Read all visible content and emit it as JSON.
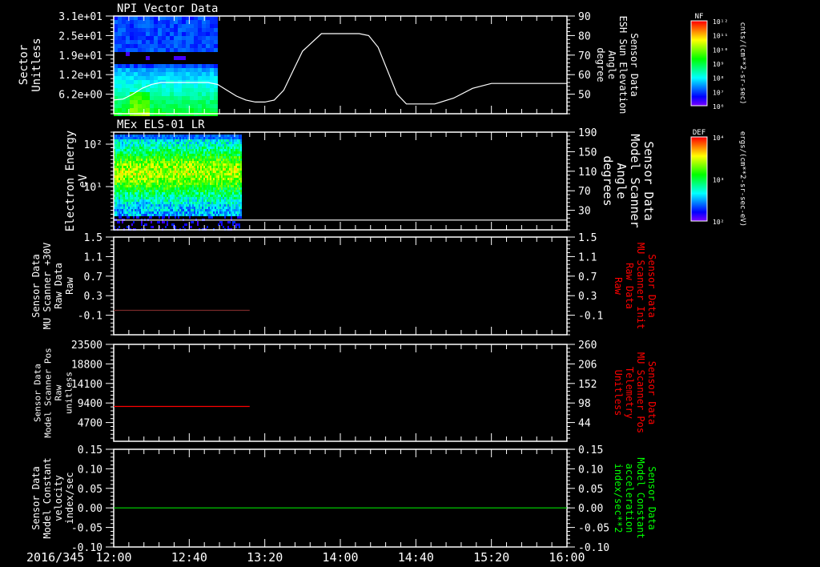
{
  "chart_data": {
    "type": "line",
    "date_label": "2016/345",
    "time_axis": {
      "start_min": 0,
      "end_min": 240,
      "labels": [
        "12:00",
        "12:40",
        "13:20",
        "14:00",
        "14:40",
        "15:20",
        "16:00"
      ],
      "label_step_min": 40,
      "minor_step_min": 8
    },
    "panels": [
      {
        "id": "npi",
        "title": "NPI Vector Data",
        "kind": "spectrogram",
        "left_label": [
          "Sector",
          "Unitless"
        ],
        "left_ticks": [
          "3.1e+01",
          "2.5e+01",
          "1.9e+01",
          "1.2e+01",
          "6.2e+00"
        ],
        "left_range": [
          0,
          31
        ],
        "right_label": [
          "Sensor Data",
          "ESH Sun Elevation",
          "Angle",
          "degree"
        ],
        "right_label_color": "#ffffff",
        "right_ticks": [
          "90",
          "80",
          "70",
          "60",
          "50"
        ],
        "right_range": [
          40,
          90
        ],
        "spectrogram_end_min": 54,
        "series": [
          {
            "name": "ESH Sun Elevation Angle",
            "color": "#ffffff",
            "x": [
              0,
              5,
              10,
              15,
              20,
              25,
              30,
              40,
              50,
              55,
              60,
              65,
              70,
              75,
              80,
              85,
              90,
              95,
              100,
              110,
              120,
              125,
              130,
              135,
              140,
              145,
              150,
              155,
              160,
              170,
              180,
              190,
              200,
              210,
              220,
              240
            ],
            "y": [
              47,
              47.5,
              50,
              53,
              55,
              56,
              56,
              56,
              56,
              55,
              52,
              49,
              47,
              46,
              46,
              47,
              52,
              62,
              72,
              81,
              81,
              81,
              81,
              80,
              74,
              62,
              50,
              45,
              45,
              45,
              48,
              53,
              55.5,
              55.5,
              55.5,
              55.5
            ]
          }
        ],
        "colorbar": {
          "title": "NF",
          "labels": [
            "10¹²",
            "10¹¹",
            "10¹⁰",
            "10⁹",
            "10⁸",
            "10⁷",
            "10⁶"
          ],
          "units": "cnts/(cm**2-sr-sec)"
        }
      },
      {
        "id": "els",
        "title": "MEx ELS-01 LR",
        "kind": "spectrogram",
        "left_label": [
          "Electron Energy",
          "eV"
        ],
        "left_ticks": [
          "10²",
          "10¹"
        ],
        "left_range_log": [
          -0.03,
          2.28
        ],
        "right_label": [
          "Sensor Data",
          "Model Scanner",
          "Angle",
          "degrees"
        ],
        "right_label_color": "#ffffff",
        "right_ticks": [
          "190",
          "150",
          "110",
          "70",
          "30"
        ],
        "right_range": [
          -10,
          190
        ],
        "spectrogram_end_min": 67,
        "series": [
          {
            "name": "Model Scanner Angle",
            "color": "#ffffff",
            "x": [
              0,
              240
            ],
            "y": [
              10,
              10
            ]
          }
        ],
        "colorbar": {
          "title": "DEF",
          "labels": [
            "10⁴",
            "10³",
            "10²"
          ],
          "units": "ergs/(cm**2-sr-sec-eV)"
        }
      },
      {
        "id": "mu30v",
        "kind": "line",
        "left_label": [
          "Sensor Data",
          "MU Scanner +30V",
          "Raw Data",
          "Raw"
        ],
        "left_ticks": [
          "1.5",
          "1.1",
          "0.7",
          "0.3",
          "-0.1"
        ],
        "left_range": [
          -0.5,
          1.5
        ],
        "right_label": [
          "Sensor Data",
          "MU Scanner Init",
          "Raw Data",
          "Raw"
        ],
        "right_label_color": "#ff0000",
        "right_ticks": [
          "1.5",
          "1.1",
          "0.7",
          "0.3",
          "-0.1"
        ],
        "series": [
          {
            "name": "MU Scanner Init Raw Data",
            "color": "#7a2a2a",
            "x": [
              0,
              72
            ],
            "y": [
              0.0,
              0.0
            ]
          }
        ]
      },
      {
        "id": "scanpos",
        "kind": "line",
        "left_label": [
          "Sensor Data",
          "Model Scanner Pos",
          "Raw",
          "unitless"
        ],
        "left_ticks": [
          "23500",
          "18800",
          "14100",
          "9400",
          "4700"
        ],
        "left_range": [
          0,
          23500
        ],
        "right_label": [
          "Sensor Data",
          "MU Scanner Pos",
          "Telemetry",
          "Unitless"
        ],
        "right_label_color": "#ff0000",
        "right_ticks": [
          "260",
          "206",
          "152",
          "98",
          "44"
        ],
        "series": [
          {
            "name": "Model Scanner Pos Raw",
            "color": "#ff0000",
            "x": [
              0,
              72
            ],
            "y": [
              8450,
              8450
            ]
          }
        ]
      },
      {
        "id": "velocity",
        "kind": "line",
        "left_label": [
          "Sensor Data",
          "Model Constant",
          "velocity",
          "index/sec"
        ],
        "left_ticks": [
          "0.15",
          "0.10",
          "0.05",
          "0.00",
          "-0.05",
          "-0.10"
        ],
        "left_range": [
          -0.1,
          0.15
        ],
        "right_label": [
          "Sensor Data",
          "Model Constant",
          "acceleration",
          "index/sec**2"
        ],
        "right_label_color": "#00ff00",
        "right_ticks": [
          "0.15",
          "0.10",
          "0.05",
          "0.00",
          "-0.05",
          "-0.10"
        ],
        "series": [
          {
            "name": "Model Constant velocity",
            "color": "#00dd00",
            "x": [
              0,
              240
            ],
            "y": [
              0,
              0
            ]
          }
        ]
      }
    ]
  }
}
